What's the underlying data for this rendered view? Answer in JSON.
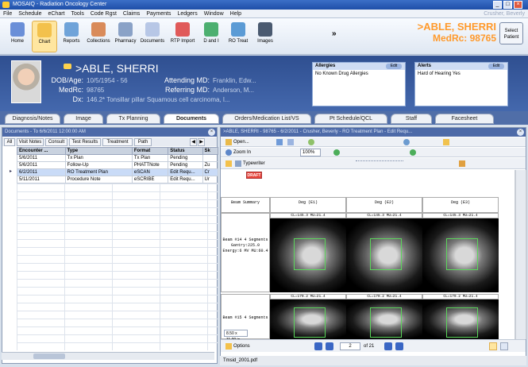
{
  "window": {
    "title": "MOSAIQ - Radiation Oncology Center",
    "user": "Crusher, Beverly"
  },
  "menu": [
    "File",
    "Schedule",
    "eChart",
    "Tools",
    "Code Rgst",
    "Claims",
    "Payments",
    "Ledgers",
    "Window",
    "Help"
  ],
  "toolbar": [
    {
      "label": "Home",
      "icon": "home-icon"
    },
    {
      "label": "Chart",
      "icon": "chart-icon"
    },
    {
      "label": "Reports",
      "icon": "reports-icon"
    },
    {
      "label": "Collections",
      "icon": "collections-icon"
    },
    {
      "label": "Pharmacy",
      "icon": "pharmacy-icon"
    },
    {
      "label": "Documents",
      "icon": "documents-icon"
    },
    {
      "label": "RTP Import",
      "icon": "rtp-import-icon"
    },
    {
      "label": "D and I",
      "icon": "d-and-i-icon"
    },
    {
      "label": "RO Treat",
      "icon": "ro-treat-icon"
    },
    {
      "label": "Images",
      "icon": "images-icon"
    }
  ],
  "toolbar_more": "»",
  "patient_header": {
    "name": ">ABLE, SHERRI",
    "mrn": "MedRc: 98765",
    "select_button": "Select Patient"
  },
  "banner": {
    "name": ">ABLE, SHERRI",
    "dob_label": "DOB/Age:",
    "dob_value": "10/5/1954 - 56",
    "medrc_label": "MedRc:",
    "medrc_value": "98765",
    "dx_label": "Dx:",
    "dx_value": "146.2* Tonsillar pillar Squamous cell carcinoma, l...",
    "attending_label": "Attending MD:",
    "attending_value": "Franklin, Edw...",
    "referring_label": "Referring MD:",
    "referring_value": "Anderson, M...",
    "allergies": {
      "title": "Allergies",
      "edit": "Edit",
      "text": "No Known Drug Allergies"
    },
    "alerts": {
      "title": "Alerts",
      "edit": "Edit",
      "text": "Hard of Hearing  Yes"
    }
  },
  "tabs": [
    "Diagnosis/Notes",
    "Image",
    "Tx Planning",
    "Documents",
    "Orders/Medication List/VS",
    "Pt Schedule/QCL",
    "Staff",
    "Facesheet"
  ],
  "active_tab": "Documents",
  "docs": {
    "title": "Documents - To 6/6/2011 12:00:00 AM",
    "subtabs": [
      "All",
      "Visit Notes",
      "Consult",
      "Test Results",
      "Treatment",
      "Path"
    ],
    "columns": [
      "Encounter ...",
      "Type",
      "Format",
      "Status",
      "Sk"
    ],
    "rows": [
      [
        "5/6/2011",
        "Tx Plan",
        "Tx Plan",
        "Pending",
        ""
      ],
      [
        "5/6/2011",
        "Follow-Up",
        "PHATTNote",
        "Pending",
        "Zu"
      ],
      [
        "6/2/2011",
        "RO Treatment Plan",
        "eSCAN",
        "Edit Requ...",
        "Cr"
      ],
      [
        "5/11/2011",
        "Procedure Note",
        "eSCRIBE",
        "Edit Requ...",
        "Ur"
      ]
    ]
  },
  "viewer": {
    "title": ">ABLE, SHERRI - 98765 - 6/2/2011 - Crusher, Beverly - RO Treatment Plan - Edit Requ...",
    "zoom": "100%",
    "open_label": "Open...",
    "zoom_in_label": "Zoom In",
    "typewriter_label": "Typewriter",
    "draft": "DRAFT",
    "plan_col_label": "Beam Summary",
    "beam_headers": [
      "Deg (E1)",
      "Deg (E2)",
      "Deg (E3)"
    ],
    "beam_rows": [
      {
        "label": "Beam #14 4 Segments Gantry:225.0 Energy:6 MV MU:60.4",
        "ct_labels": [
          "CL=145.3 MU=21.4",
          "CL=145.3 MU=21.4",
          "CL=145.3 MU=21.4"
        ]
      },
      {
        "label": "Beam #15 4 Segments",
        "ct_labels": [
          "CL=170.2 MU=21.4",
          "CL=170.2 MU=21.4",
          "CL=170.2 MU=21.4"
        ]
      }
    ],
    "page_size": "8.50 x 11.00 in",
    "page_current": "2",
    "page_total": "of 21",
    "options_label": "Options",
    "file": "Tmsid_2001.pdf"
  }
}
